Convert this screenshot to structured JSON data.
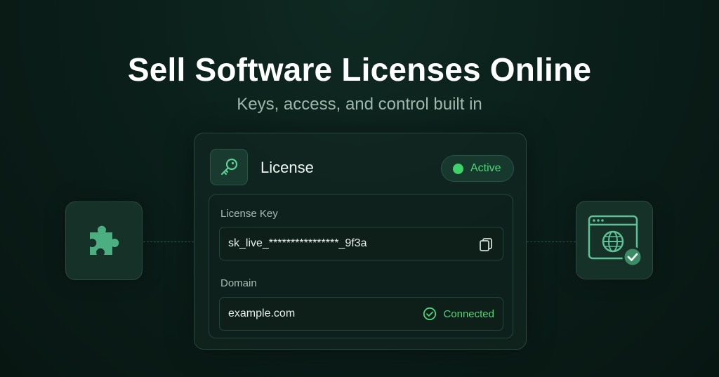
{
  "hero": {
    "title": "Sell Software Licenses Online",
    "subtitle": "Keys, access, and control built in"
  },
  "card": {
    "title": "License",
    "status": "Active",
    "license_key_label": "License Key",
    "license_key_value": "sk_live_****************_9f3a",
    "domain_label": "Domain",
    "domain_value": "example.com",
    "domain_status": "Connected"
  },
  "icons": {
    "card_badge": "key-icon",
    "copy": "copy-icon",
    "connected": "check-circle-icon",
    "left_tile": "puzzle-icon",
    "right_tile": "globe-window-check-icon"
  },
  "colors": {
    "background": "#0b1f1a",
    "accent_green": "#4fd57a",
    "status_dot": "#3fd16a",
    "card_border": "#2a4a3f"
  }
}
